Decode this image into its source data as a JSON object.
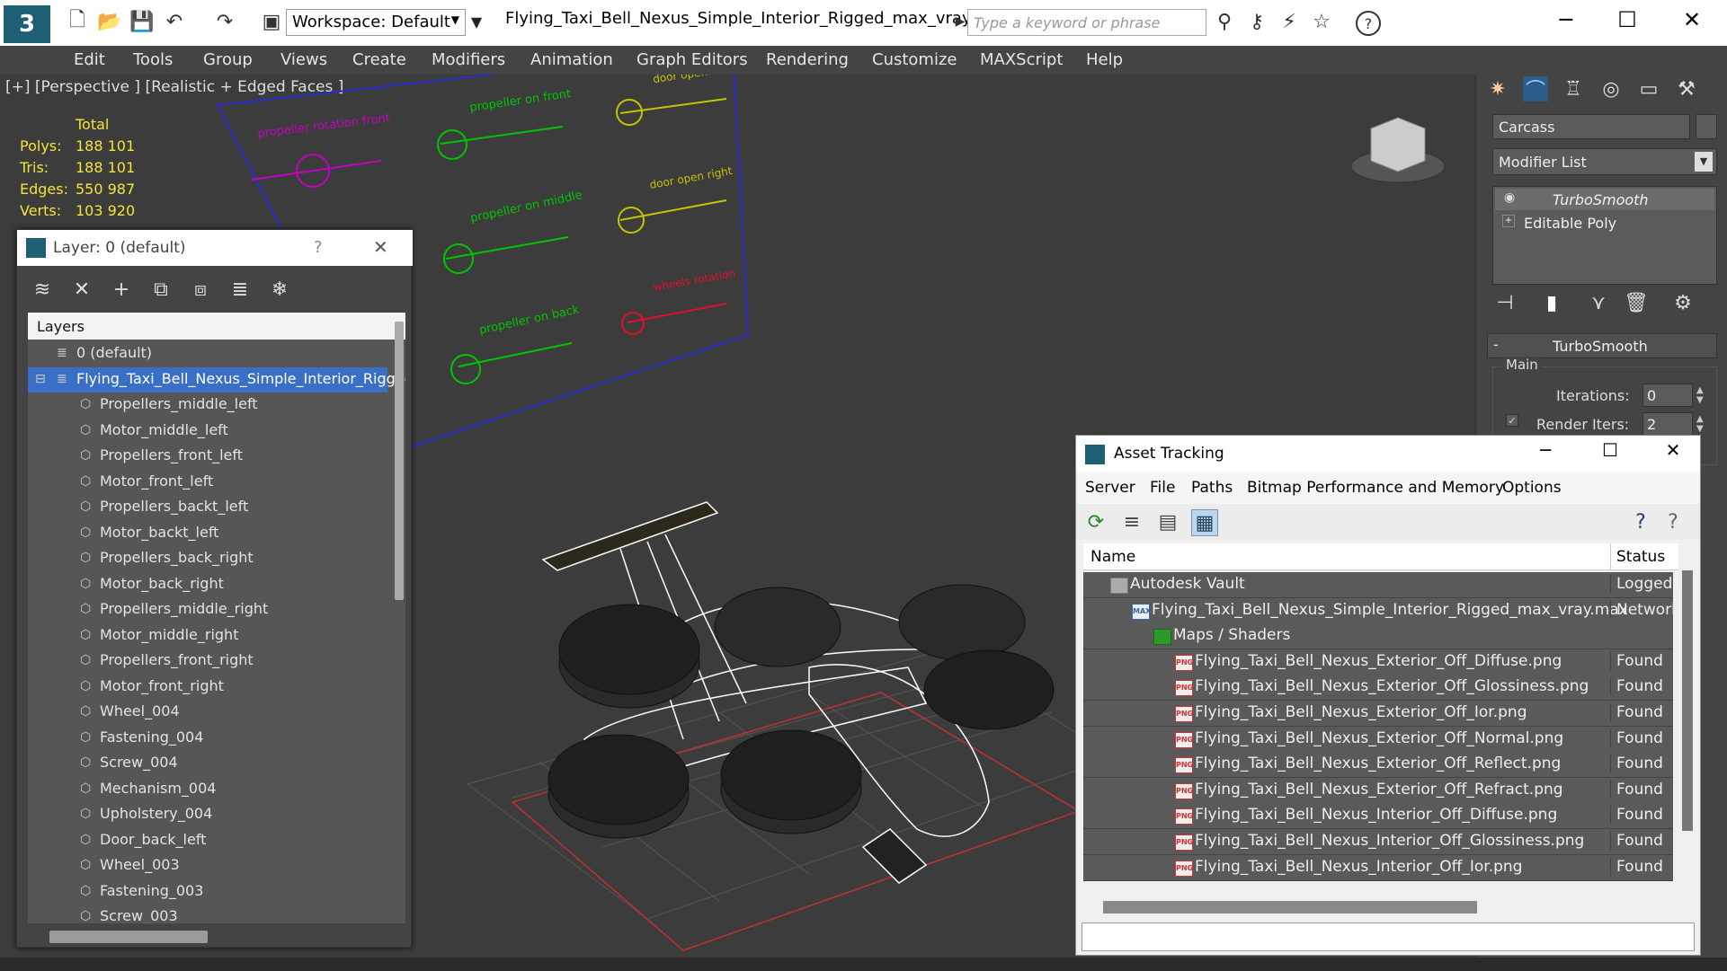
{
  "titlebar": {
    "workspace": "Workspace: Default",
    "doc_title": "Flying_Taxi_Bell_Nexus_Simple_Interior_Rigged_max_vray.max",
    "search_placeholder": "Type a keyword or phrase"
  },
  "menu": [
    "Edit",
    "Tools",
    "Group",
    "Views",
    "Create",
    "Modifiers",
    "Animation",
    "Graph Editors",
    "Rendering",
    "Customize",
    "MAXScript",
    "Help"
  ],
  "viewport": {
    "label": "[+] [Perspective ] [Realistic + Edged Faces ]",
    "stats": {
      "header": "Total",
      "rows": [
        {
          "label": "Polys:",
          "value": "188 101"
        },
        {
          "label": "Tris:",
          "value": "188 101"
        },
        {
          "label": "Edges:",
          "value": "550 987"
        },
        {
          "label": "Verts:",
          "value": "103 920"
        }
      ]
    },
    "rig_labels": [
      {
        "text": "propeller rotation front",
        "color": "#c400c4"
      },
      {
        "text": "propeller on front",
        "color": "#00c400"
      },
      {
        "text": "door open",
        "color": "#c4c400"
      },
      {
        "text": "propeller on middle",
        "color": "#00c400"
      },
      {
        "text": "door open right",
        "color": "#c4c400"
      },
      {
        "text": "propeller on back",
        "color": "#00c400"
      },
      {
        "text": "wheels rotation",
        "color": "#e0102a"
      }
    ]
  },
  "layer_panel": {
    "title": "Layer: 0 (default)",
    "help": "?",
    "close": "✕",
    "list_header": "Layers",
    "default_layer": "0 (default)",
    "selected_layer": "Flying_Taxi_Bell_Nexus_Simple_Interior_Rigged",
    "objects": [
      "Propellers_middle_left",
      "Motor_middle_left",
      "Propellers_front_left",
      "Motor_front_left",
      "Propellers_backt_left",
      "Motor_backt_left",
      "Propellers_back_right",
      "Motor_back_right",
      "Propellers_middle_right",
      "Motor_middle_right",
      "Propellers_front_right",
      "Motor_front_right",
      "Wheel_004",
      "Fastening_004",
      "Screw_004",
      "Mechanism_004",
      "Upholstery_004",
      "Door_back_left",
      "Wheel_003",
      "Fastening_003",
      "Screw_003"
    ]
  },
  "command_panel": {
    "object_name": "Carcass",
    "modifier_list": "Modifier List",
    "stack": [
      "TurboSmooth",
      "Editable Poly"
    ],
    "rollout_title": "TurboSmooth",
    "group": "Main",
    "iterations_label": "Iterations:",
    "iterations_value": "0",
    "render_iters_label": "Render Iters:",
    "render_iters_value": "2"
  },
  "asset_tracking": {
    "title": "Asset Tracking",
    "menu": [
      "Server",
      "File",
      "Paths",
      "Bitmap Performance and Memory",
      "Options"
    ],
    "col_name": "Name",
    "col_status": "Status",
    "rows": [
      {
        "name": "Autodesk Vault",
        "status": "Logged Out",
        "indent": 0,
        "icon": "vault"
      },
      {
        "name": "Flying_Taxi_Bell_Nexus_Simple_Interior_Rigged_max_vray.max",
        "status": "Network",
        "indent": 1,
        "icon": "max"
      },
      {
        "name": "Maps / Shaders",
        "status": "",
        "indent": 2,
        "icon": "maps"
      },
      {
        "name": "Flying_Taxi_Bell_Nexus_Exterior_Off_Diffuse.png",
        "status": "Found",
        "indent": 3,
        "icon": "png"
      },
      {
        "name": "Flying_Taxi_Bell_Nexus_Exterior_Off_Glossiness.png",
        "status": "Found",
        "indent": 3,
        "icon": "png"
      },
      {
        "name": "Flying_Taxi_Bell_Nexus_Exterior_Off_Ior.png",
        "status": "Found",
        "indent": 3,
        "icon": "png"
      },
      {
        "name": "Flying_Taxi_Bell_Nexus_Exterior_Off_Normal.png",
        "status": "Found",
        "indent": 3,
        "icon": "png"
      },
      {
        "name": "Flying_Taxi_Bell_Nexus_Exterior_Off_Reflect.png",
        "status": "Found",
        "indent": 3,
        "icon": "png"
      },
      {
        "name": "Flying_Taxi_Bell_Nexus_Exterior_Off_Refract.png",
        "status": "Found",
        "indent": 3,
        "icon": "png"
      },
      {
        "name": "Flying_Taxi_Bell_Nexus_Interior_Off_Diffuse.png",
        "status": "Found",
        "indent": 3,
        "icon": "png"
      },
      {
        "name": "Flying_Taxi_Bell_Nexus_Interior_Off_Glossiness.png",
        "status": "Found",
        "indent": 3,
        "icon": "png"
      },
      {
        "name": "Flying_Taxi_Bell_Nexus_Interior_Off_Ior.png",
        "status": "Found",
        "indent": 3,
        "icon": "png"
      }
    ]
  }
}
